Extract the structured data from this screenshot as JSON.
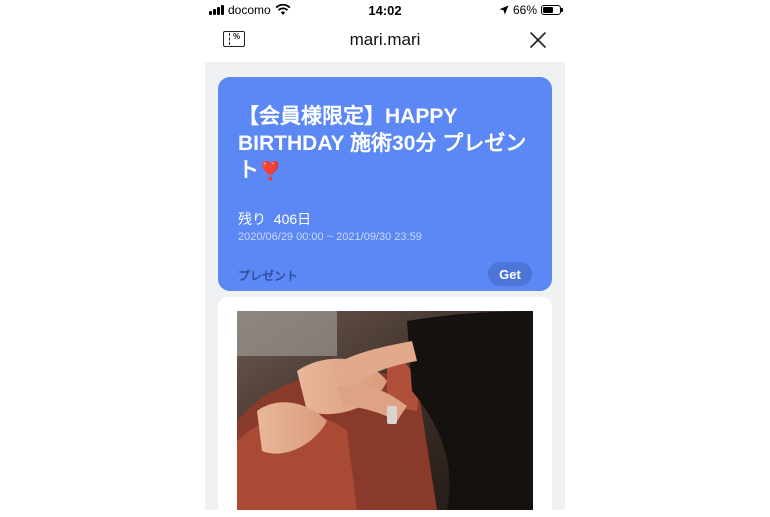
{
  "status_bar": {
    "carrier": "docomo",
    "time": "14:02",
    "battery_percent": "66%",
    "battery_level": 0.66
  },
  "navbar": {
    "title": "mari.mari",
    "left_icon": "coupon-icon",
    "right_icon": "close-icon"
  },
  "coupon": {
    "headline": "【会員様限定】HAPPY BIRTHDAY 施術30分 プレゼント",
    "emoji": "❣️",
    "remaining": "残り  406日",
    "period": "2020/06/29 00:00 ~ 2021/09/30 23:59",
    "type_label": "プレゼント",
    "get_label": "Get",
    "background_color": "#5b88f5"
  },
  "detail": {
    "image_description_icon": "photo-facial-treatment"
  }
}
